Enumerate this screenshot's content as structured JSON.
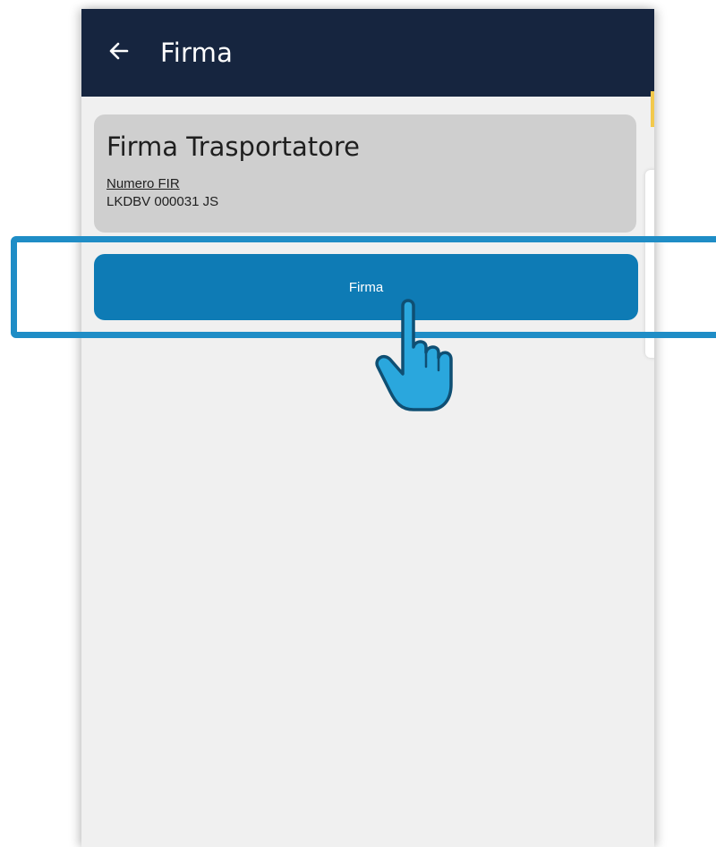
{
  "appbar": {
    "title": "Firma",
    "back_icon": "arrow-left-icon",
    "color": "#16253f"
  },
  "card": {
    "title": "Firma Trasportatore",
    "field_label": "Numero FIR",
    "field_value": "LKDBV 000031 JS",
    "color": "#cfcfcf"
  },
  "action": {
    "sign_label": "Firma",
    "color": "#0e7bb5"
  },
  "overlay": {
    "highlight_color": "#1f8dc6",
    "pointer_icon": "hand-pointer-icon"
  }
}
